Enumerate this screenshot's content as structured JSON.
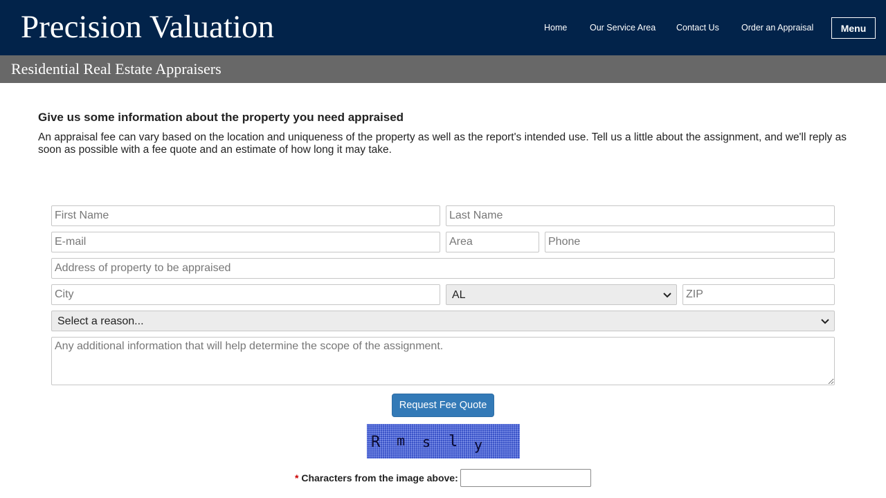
{
  "header": {
    "brand": "Precision Valuation",
    "nav": [
      "Home",
      "Our Service Area",
      "Contact Us",
      "Order an Appraisal"
    ],
    "menu_label": "Menu",
    "tagline": "Residential Real Estate Appraisers"
  },
  "content": {
    "heading": "Give us some information about the property you need appraised",
    "intro": "An appraisal fee can vary based on the location and uniqueness of the property as well as the report's intended use. Tell us a little about the assignment, and we'll reply as soon as possible with a fee quote and an estimate of how long it may take."
  },
  "form": {
    "first_name_placeholder": "First Name",
    "last_name_placeholder": "Last Name",
    "email_placeholder": "E-mail",
    "area_placeholder": "Area",
    "phone_placeholder": "Phone",
    "address_placeholder": "Address of property to be appraised",
    "city_placeholder": "City",
    "state_value": "AL",
    "zip_placeholder": "ZIP",
    "reason_value": "Select a reason...",
    "notes_placeholder": "Any additional information that will help determine the scope of the assignment.",
    "submit_label": "Request Fee Quote",
    "captcha_chars": [
      "R",
      "m",
      "s",
      "l",
      "y"
    ],
    "captcha_required_mark": "*",
    "captcha_label": "Characters from the image above:"
  },
  "colors": {
    "header_bg": "#02234a",
    "subbar_bg": "#686868",
    "button_bg": "#337ab7",
    "captcha_bg": "#3a53c8"
  }
}
